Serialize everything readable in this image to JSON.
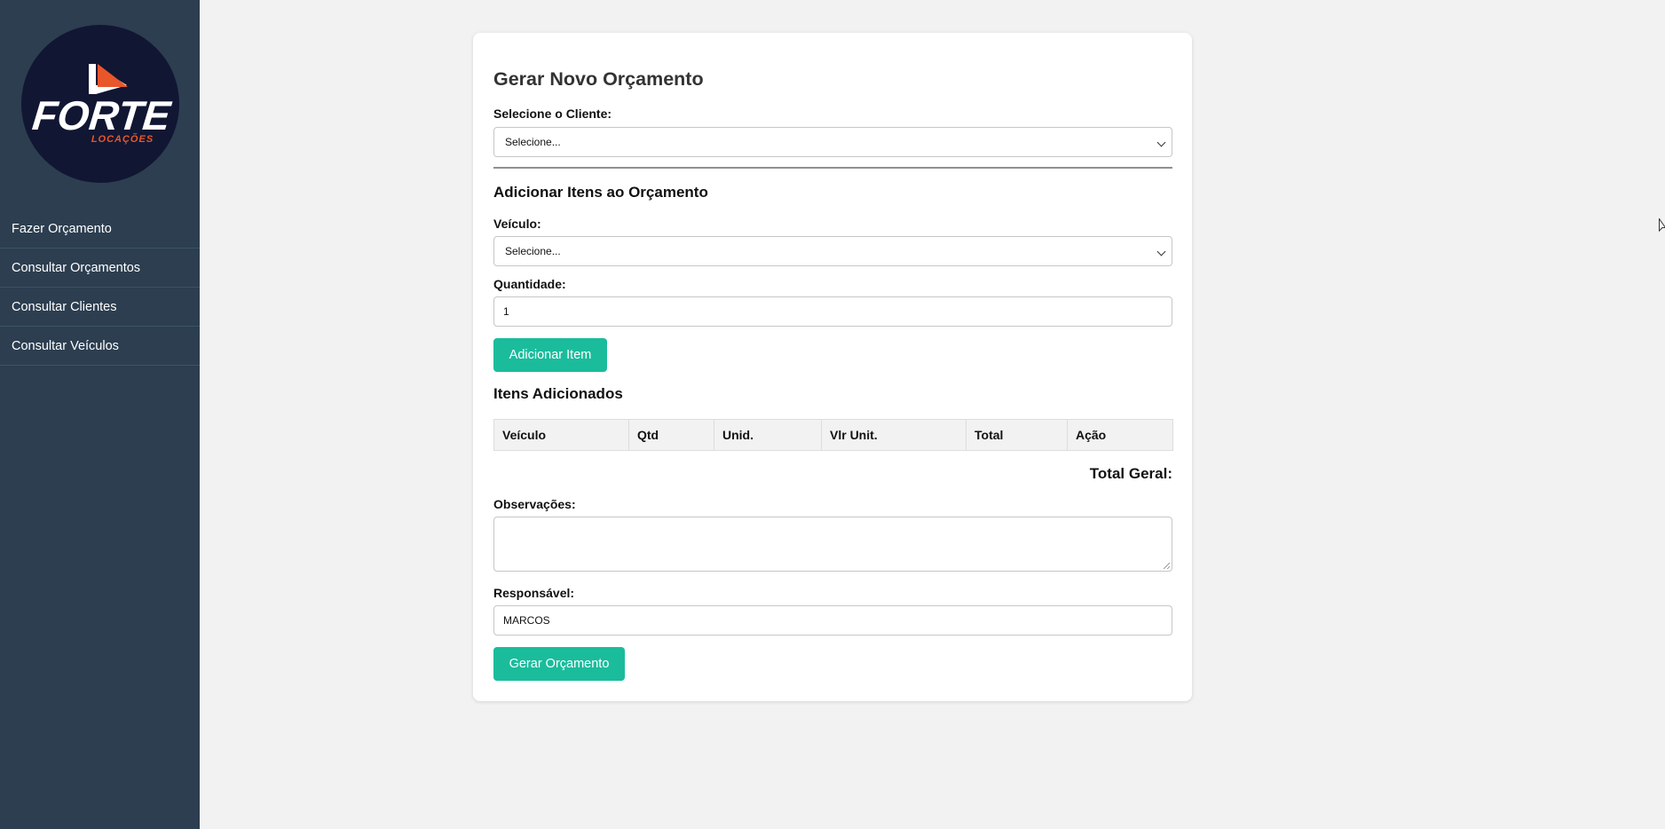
{
  "sidebar": {
    "logo": {
      "brand": "FORTE",
      "tagline": "LOCAÇÕES",
      "colors": {
        "circle": "#111633",
        "text": "#ffffff",
        "accent": "#e8562a"
      }
    },
    "items": [
      {
        "label": "Fazer Orçamento"
      },
      {
        "label": "Consultar Orçamentos"
      },
      {
        "label": "Consultar Clientes"
      },
      {
        "label": "Consultar Veículos"
      }
    ]
  },
  "form": {
    "title": "Gerar Novo Orçamento",
    "client_label": "Selecione o Cliente:",
    "client_selected": "Selecione...",
    "add_items_title": "Adicionar Itens ao Orçamento",
    "vehicle_label": "Veículo:",
    "vehicle_selected": "Selecione...",
    "quantity_label": "Quantidade:",
    "quantity_value": "1",
    "add_item_button": "Adicionar Item",
    "items_title": "Itens Adicionados",
    "table_headers": [
      "Veículo",
      "Qtd",
      "Unid.",
      "Vlr Unit.",
      "Total",
      "Ação"
    ],
    "total_label": "Total Geral:",
    "notes_label": "Observações:",
    "notes_value": "",
    "responsible_label": "Responsável:",
    "responsible_value": "MARCOS",
    "submit_button": "Gerar Orçamento"
  },
  "colors": {
    "sidebar_bg": "#2c3e50",
    "page_bg": "#f2f2f2",
    "accent": "#1abc9c"
  }
}
